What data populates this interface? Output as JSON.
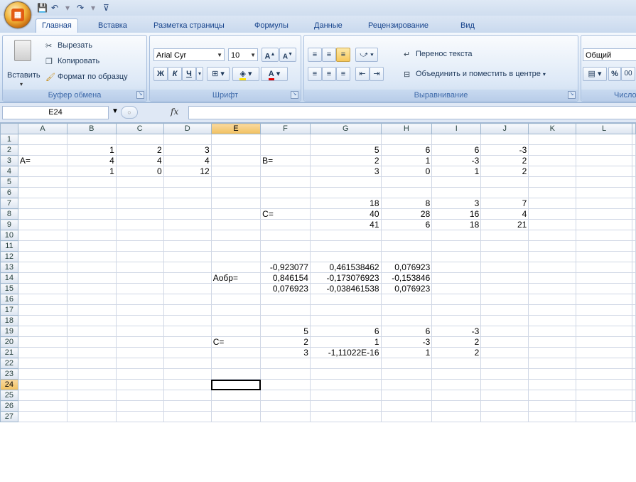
{
  "quick_access": {
    "save_icon": "save-icon",
    "undo_icon": "undo-icon",
    "redo_icon": "redo-icon",
    "customize_icon": "customize-arrow"
  },
  "tabs": [
    {
      "label": "Главная",
      "active": true
    },
    {
      "label": "Вставка"
    },
    {
      "label": "Разметка страницы"
    },
    {
      "label": "Формулы"
    },
    {
      "label": "Данные"
    },
    {
      "label": "Рецензирование"
    },
    {
      "label": "Вид"
    }
  ],
  "ribbon": {
    "clipboard": {
      "label": "Буфер обмена",
      "paste": "Вставить",
      "cut": "Вырезать",
      "copy": "Копировать",
      "format_painter": "Формат по образцу"
    },
    "font": {
      "label": "Шрифт",
      "font_name": "Arial Cyr",
      "font_size": "10",
      "bold": "Ж",
      "italic": "К",
      "underline": "Ч",
      "grow": "A",
      "shrink": "A"
    },
    "alignment": {
      "label": "Выравнивание",
      "wrap_text": "Перенос текста",
      "merge_center": "Объединить и поместить в центре"
    },
    "number": {
      "label": "Число",
      "format": "Общий",
      "percent": "%",
      "comma": "00"
    }
  },
  "formula_bar": {
    "name_box": "E24",
    "fx": "fx",
    "formula": ""
  },
  "sheet": {
    "columns": [
      "A",
      "B",
      "C",
      "D",
      "E",
      "F",
      "G",
      "H",
      "I",
      "J",
      "K",
      "L"
    ],
    "selected_column": "E",
    "selected_row": 24,
    "rows": [
      {
        "n": 1,
        "cells": {}
      },
      {
        "n": 2,
        "cells": {
          "B": "1",
          "C": "2",
          "D": "3",
          "G": "5",
          "H": "6",
          "I": "6",
          "J": "-3"
        }
      },
      {
        "n": 3,
        "cells": {
          "A": "A=",
          "B": "4",
          "C": "4",
          "D": "4",
          "F": "B=",
          "G": "2",
          "H": "1",
          "I": "-3",
          "J": "2"
        }
      },
      {
        "n": 4,
        "cells": {
          "B": "1",
          "C": "0",
          "D": "12",
          "G": "3",
          "H": "0",
          "I": "1",
          "J": "2"
        }
      },
      {
        "n": 5,
        "cells": {}
      },
      {
        "n": 6,
        "cells": {}
      },
      {
        "n": 7,
        "cells": {
          "G": "18",
          "H": "8",
          "I": "3",
          "J": "7"
        }
      },
      {
        "n": 8,
        "cells": {
          "F": "C=",
          "G": "40",
          "H": "28",
          "I": "16",
          "J": "4"
        }
      },
      {
        "n": 9,
        "cells": {
          "G": "41",
          "H": "6",
          "I": "18",
          "J": "21"
        }
      },
      {
        "n": 10,
        "cells": {}
      },
      {
        "n": 11,
        "cells": {}
      },
      {
        "n": 12,
        "cells": {}
      },
      {
        "n": 13,
        "cells": {
          "F": "-0,923077",
          "G": "0,461538462",
          "H": "0,076923"
        }
      },
      {
        "n": 14,
        "cells": {
          "E": "Аобр=",
          "F": "0,846154",
          "G": "-0,173076923",
          "H": "-0,153846"
        }
      },
      {
        "n": 15,
        "cells": {
          "F": "0,076923",
          "G": "-0,038461538",
          "H": "0,076923"
        }
      },
      {
        "n": 16,
        "cells": {}
      },
      {
        "n": 17,
        "cells": {}
      },
      {
        "n": 18,
        "cells": {}
      },
      {
        "n": 19,
        "cells": {
          "F": "5",
          "G": "6",
          "H": "6",
          "I": "-3"
        }
      },
      {
        "n": 20,
        "cells": {
          "E": "C=",
          "F": "2",
          "G": "1",
          "H": "-3",
          "I": "2"
        }
      },
      {
        "n": 21,
        "cells": {
          "F": "3",
          "G": "-1,11022E-16",
          "H": "1",
          "I": "2"
        }
      },
      {
        "n": 22,
        "cells": {}
      },
      {
        "n": 23,
        "cells": {}
      },
      {
        "n": 24,
        "cells": {}
      },
      {
        "n": 25,
        "cells": {}
      },
      {
        "n": 26,
        "cells": {}
      },
      {
        "n": 27,
        "cells": {}
      }
    ]
  }
}
